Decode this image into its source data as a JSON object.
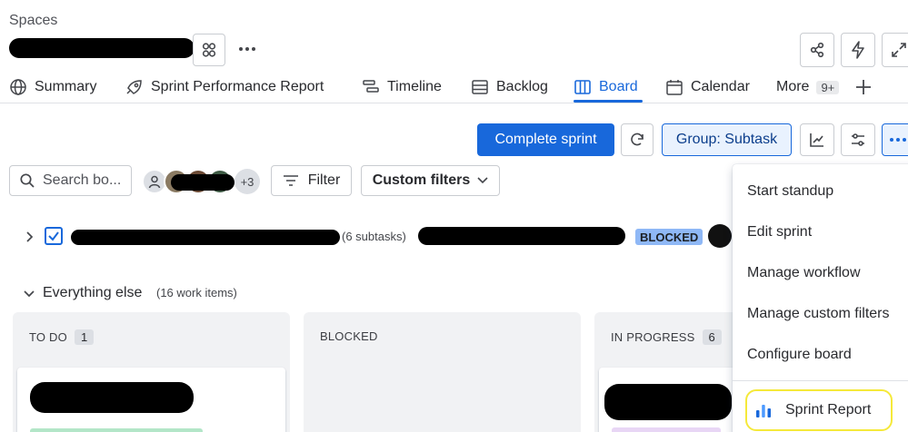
{
  "header": {
    "breadcrumb": "Spaces"
  },
  "tabs": [
    {
      "label": "Summary",
      "icon": "globe-icon"
    },
    {
      "label": "Sprint Performance Report",
      "icon": "rocket-icon"
    },
    {
      "label": "Timeline",
      "icon": "timeline-icon"
    },
    {
      "label": "Backlog",
      "icon": "backlog-icon"
    },
    {
      "label": "Board",
      "icon": "board-icon",
      "active": true
    },
    {
      "label": "Calendar",
      "icon": "calendar-icon"
    },
    {
      "label": "More",
      "badge": "9+"
    }
  ],
  "toolbar": {
    "complete_sprint": "Complete sprint",
    "group_by": "Group: Subtask"
  },
  "filters": {
    "search_placeholder": "Search bo...",
    "avatar_extra": "+3",
    "filter_label": "Filter",
    "custom_filters_label": "Custom filters"
  },
  "parent_item": {
    "subtasks": "(6 subtasks)",
    "status": "BLOCKED"
  },
  "swimlane": {
    "title": "Everything else",
    "count": "(16 work items)"
  },
  "columns": [
    {
      "name": "TO DO",
      "count": "1"
    },
    {
      "name": "BLOCKED",
      "count": ""
    },
    {
      "name": "IN PROGRESS",
      "count": "6"
    }
  ],
  "menu": {
    "items": [
      "Start standup",
      "Edit sprint",
      "Manage workflow",
      "Manage custom filters",
      "Configure board"
    ],
    "highlight": "Sprint Report"
  },
  "colors": {
    "primary": "#1868db",
    "active_tab": "#1868db",
    "blocked_badge_bg": "#8fb8f6",
    "group_bg": "#e9f2fe",
    "annotation": "#f5e93a"
  }
}
